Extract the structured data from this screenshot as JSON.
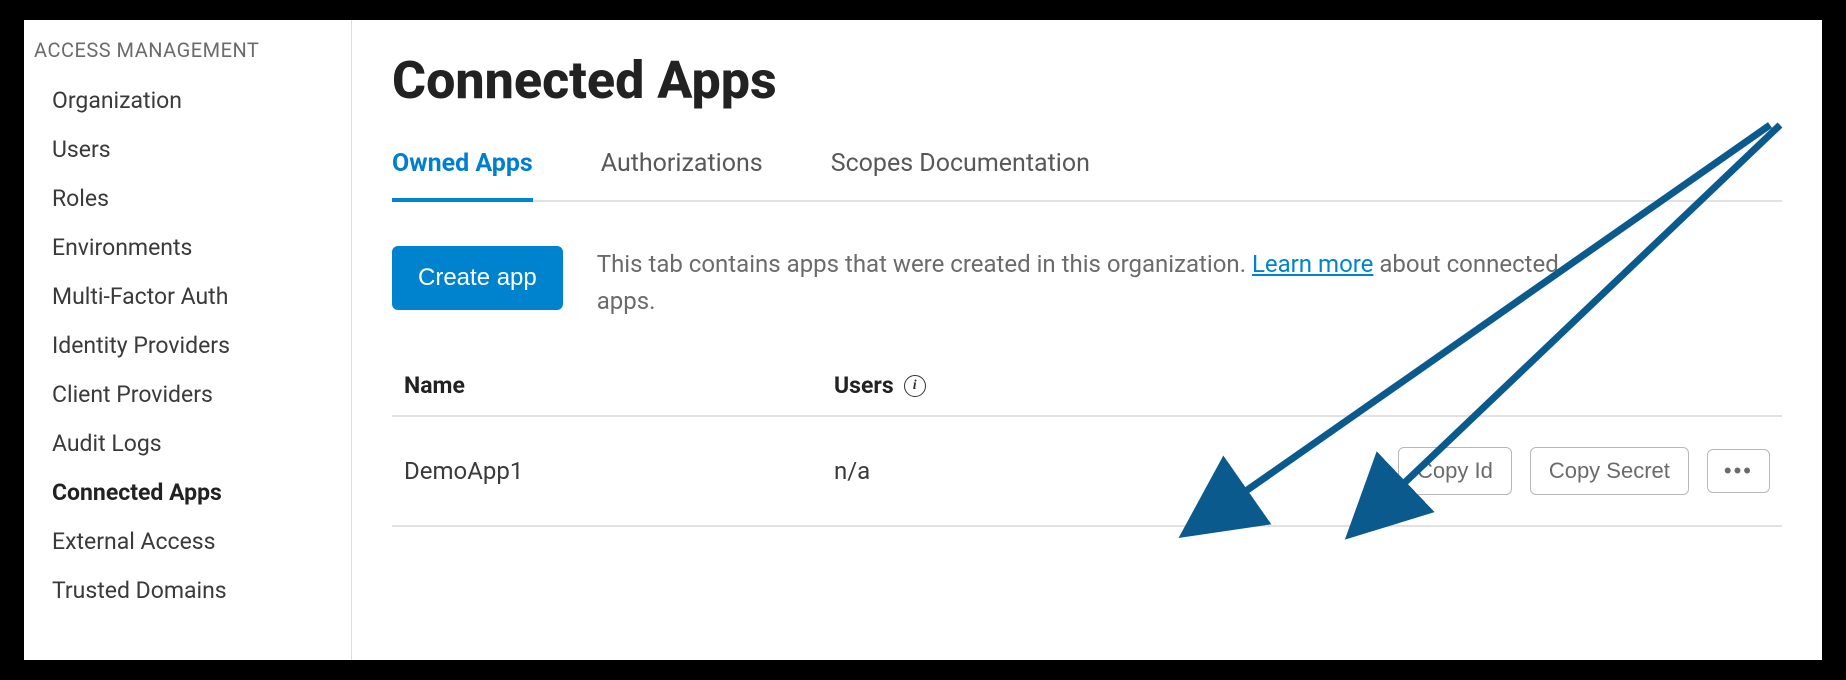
{
  "sidebar": {
    "section_title": "ACCESS MANAGEMENT",
    "items": [
      {
        "label": "Organization",
        "active": false
      },
      {
        "label": "Users",
        "active": false
      },
      {
        "label": "Roles",
        "active": false
      },
      {
        "label": "Environments",
        "active": false
      },
      {
        "label": "Multi-Factor Auth",
        "active": false
      },
      {
        "label": "Identity Providers",
        "active": false
      },
      {
        "label": "Client Providers",
        "active": false
      },
      {
        "label": "Audit Logs",
        "active": false
      },
      {
        "label": "Connected Apps",
        "active": true
      },
      {
        "label": "External Access",
        "active": false
      },
      {
        "label": "Trusted Domains",
        "active": false
      }
    ]
  },
  "page": {
    "title": "Connected Apps"
  },
  "tabs": [
    {
      "label": "Owned Apps",
      "active": true
    },
    {
      "label": "Authorizations",
      "active": false
    },
    {
      "label": "Scopes Documentation",
      "active": false
    }
  ],
  "actions": {
    "create_label": "Create app",
    "description_pre": "This tab contains apps that were created in this organization. ",
    "learn_more": "Learn more",
    "description_post": " about connected apps."
  },
  "table": {
    "headers": {
      "name": "Name",
      "users": "Users"
    },
    "rows": [
      {
        "name": "DemoApp1",
        "users": "n/a",
        "copy_id": "Copy Id",
        "copy_secret": "Copy Secret"
      }
    ]
  },
  "annotation": {
    "arrow_color": "#0b5a8e"
  }
}
